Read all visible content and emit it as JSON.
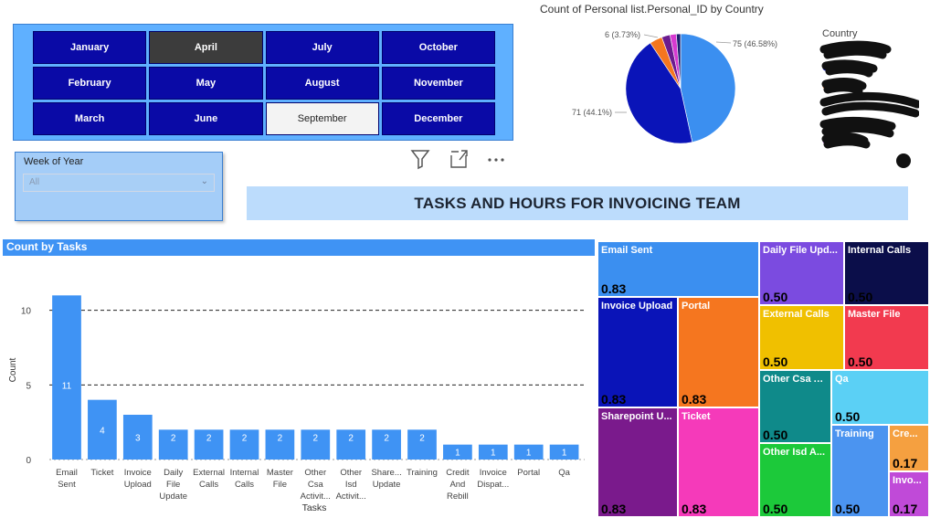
{
  "months": {
    "items": [
      "January",
      "April",
      "July",
      "October",
      "February",
      "May",
      "August",
      "November",
      "March",
      "June",
      "September",
      "December"
    ],
    "hovered": "April",
    "selected": "September"
  },
  "week_filter": {
    "label": "Week of Year",
    "value": "All"
  },
  "visual_header": {
    "icons": [
      "filter-icon",
      "focus-mode-icon",
      "more-options-icon"
    ]
  },
  "banner": {
    "title": "TASKS AND HOURS FOR INVOICING TEAM"
  },
  "pie_chart": {
    "title": "Count of Personal list.Personal_ID by Country",
    "legend_title": "Country",
    "labels": {
      "slice1": "75 (46.58%)",
      "slice2": "71 (44.1%)",
      "slice3": "6 (3.73%)"
    }
  },
  "chart_data": [
    {
      "type": "pie",
      "title": "Count of Personal list.Personal_ID by Country",
      "legend_title": "Country",
      "slices": [
        {
          "value": 75,
          "label": "75 (46.58%)",
          "color": "#3b8ff0"
        },
        {
          "value": 71,
          "label": "71 (44.1%)",
          "color": "#0a14b8"
        },
        {
          "value": 6,
          "label": "6 (3.73%)",
          "color": "#f5761f"
        },
        {
          "value": 4,
          "label": "",
          "color": "#6b1b8f"
        },
        {
          "value": 3,
          "label": "",
          "color": "#d63ad0"
        },
        {
          "value": 2,
          "label": "",
          "color": "#1c1f6e"
        }
      ]
    },
    {
      "type": "bar",
      "title": "Count by Tasks",
      "xlabel": "Tasks",
      "ylabel": "Count",
      "ylim": [
        0,
        12
      ],
      "yticks": [
        0,
        5,
        10
      ],
      "categories": [
        "Email Sent",
        "Ticket",
        "Invoice Upload",
        "Daily File Update",
        "External Calls",
        "Internal Calls",
        "Master File",
        "Other Csa Activit...",
        "Other Isd Activit...",
        "Share... Update",
        "Training",
        "Credit And Rebill",
        "Invoice Dispat...",
        "Portal",
        "Qa"
      ],
      "category_lines": [
        [
          "Email",
          "Sent"
        ],
        [
          "Ticket"
        ],
        [
          "Invoice",
          "Upload"
        ],
        [
          "Daily",
          "File",
          "Update"
        ],
        [
          "External",
          "Calls"
        ],
        [
          "Internal",
          "Calls"
        ],
        [
          "Master",
          "File"
        ],
        [
          "Other",
          "Csa",
          "Activit..."
        ],
        [
          "Other",
          "Isd",
          "Activit..."
        ],
        [
          "Share...",
          "Update"
        ],
        [
          "Training"
        ],
        [
          "Credit",
          "And",
          "Rebill"
        ],
        [
          "Invoice",
          "Dispat..."
        ],
        [
          "Portal"
        ],
        [
          "Qa"
        ]
      ],
      "values": [
        11,
        4,
        3,
        2,
        2,
        2,
        2,
        2,
        2,
        2,
        2,
        1,
        1,
        1,
        1
      ],
      "bar_color": "#3f93f4"
    },
    {
      "type": "treemap",
      "tiles": [
        {
          "name": "Email Sent",
          "value": "0.83",
          "color": "#3b8ff0"
        },
        {
          "name": "Invoice Upload",
          "value": "0.83",
          "color": "#0a14b8"
        },
        {
          "name": "Portal",
          "value": "0.83",
          "color": "#f5761f"
        },
        {
          "name": "Sharepoint U...",
          "value": "0.83",
          "color": "#7a1a8c"
        },
        {
          "name": "Ticket",
          "value": "0.83",
          "color": "#f53aba"
        },
        {
          "name": "Daily File Upd...",
          "value": "0.50",
          "color": "#7b4be0"
        },
        {
          "name": "Internal Calls",
          "value": "0.50",
          "color": "#0b0e4a"
        },
        {
          "name": "External Calls",
          "value": "0.50",
          "color": "#f0c000"
        },
        {
          "name": "Master File",
          "value": "0.50",
          "color": "#f23a4f"
        },
        {
          "name": "Other Csa A...",
          "value": "0.50",
          "color": "#0f8a8a"
        },
        {
          "name": "Qa",
          "value": "0.50",
          "color": "#5bd0f5"
        },
        {
          "name": "Other Isd A...",
          "value": "0.50",
          "color": "#1cc93a"
        },
        {
          "name": "Training",
          "value": "0.50",
          "color": "#4b94f0"
        },
        {
          "name": "Cre...",
          "value": "0.17",
          "color": "#f5a040"
        },
        {
          "name": "Invo...",
          "value": "0.17",
          "color": "#c04ad8"
        }
      ]
    }
  ]
}
